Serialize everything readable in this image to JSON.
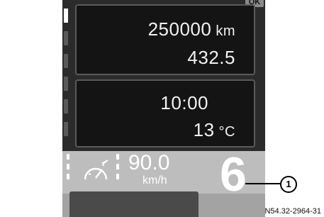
{
  "top_tab": {
    "label": "OK"
  },
  "odometer_panel": {
    "total_distance": "250000",
    "total_distance_unit": "km",
    "trip_distance": "432.5"
  },
  "clock_panel": {
    "time": "10:00",
    "temperature": "13",
    "temperature_unit": "°C"
  },
  "speed_display": {
    "value": "90.0",
    "unit": "km/h",
    "icon": "speedometer-icon"
  },
  "gear_display": {
    "gear": "6"
  },
  "callout": {
    "number": "1"
  },
  "figure_code": "N54.32-2964-31"
}
